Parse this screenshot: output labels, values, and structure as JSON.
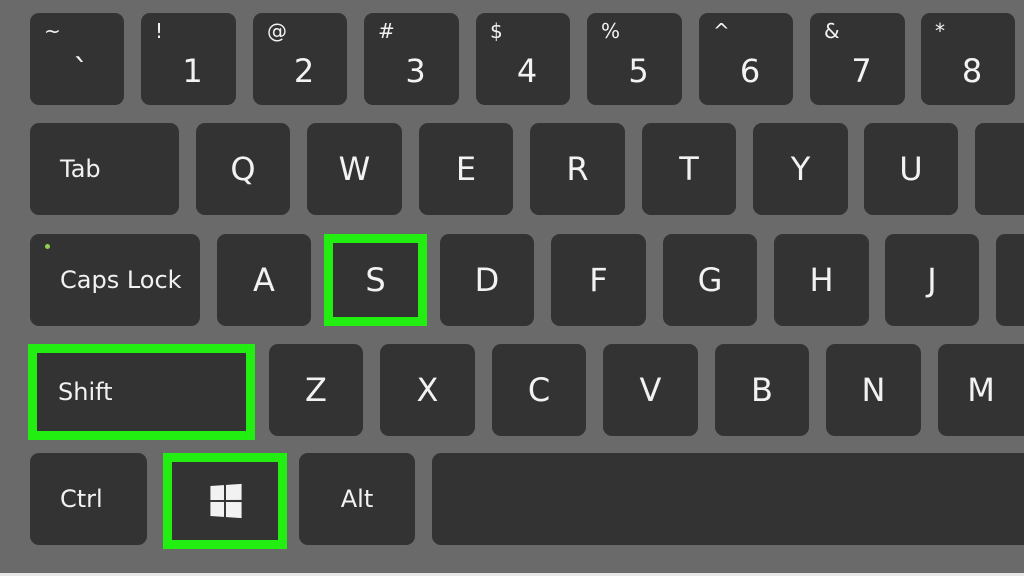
{
  "colors": {
    "background": "#6a6a6a",
    "key": "#333333",
    "label": "#f2f2f2",
    "highlight": "#22ee11",
    "caps_led": "#8fd14f"
  },
  "highlighted_keys": [
    "S",
    "Shift",
    "Windows"
  ],
  "rows": [
    [
      {
        "label": "`",
        "shift": "~"
      },
      {
        "label": "1",
        "shift": "!"
      },
      {
        "label": "2",
        "shift": "@"
      },
      {
        "label": "3",
        "shift": "#"
      },
      {
        "label": "4",
        "shift": "$"
      },
      {
        "label": "5",
        "shift": "%"
      },
      {
        "label": "6",
        "shift": "^"
      },
      {
        "label": "7",
        "shift": "&"
      },
      {
        "label": "8",
        "shift": "*"
      }
    ],
    [
      {
        "label": "Tab"
      },
      {
        "label": "Q"
      },
      {
        "label": "W"
      },
      {
        "label": "E"
      },
      {
        "label": "R"
      },
      {
        "label": "T"
      },
      {
        "label": "Y"
      },
      {
        "label": "U"
      },
      {
        "label": ""
      }
    ],
    [
      {
        "label": "Caps Lock",
        "led": true
      },
      {
        "label": "A"
      },
      {
        "label": "S",
        "highlighted": true
      },
      {
        "label": "D"
      },
      {
        "label": "F"
      },
      {
        "label": "G"
      },
      {
        "label": "H"
      },
      {
        "label": "J"
      },
      {
        "label": ""
      }
    ],
    [
      {
        "label": "Shift",
        "highlighted": true
      },
      {
        "label": "Z"
      },
      {
        "label": "X"
      },
      {
        "label": "C"
      },
      {
        "label": "V"
      },
      {
        "label": "B"
      },
      {
        "label": "N"
      },
      {
        "label": "M"
      }
    ],
    [
      {
        "label": "Ctrl"
      },
      {
        "label": "",
        "icon": "windows-logo-icon",
        "highlighted": true
      },
      {
        "label": "Alt"
      },
      {
        "label": ""
      }
    ]
  ]
}
